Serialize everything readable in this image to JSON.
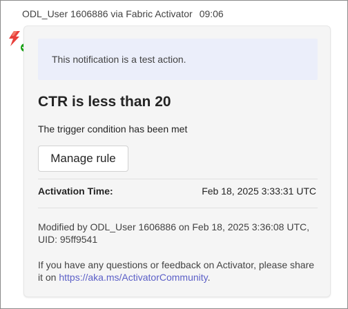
{
  "message": {
    "sender": "ODL_User 1606886 via Fabric Activator",
    "time": "09:06",
    "avatar_icon": "activator-lightning-icon",
    "presence_status": "available",
    "presence_color": "#13a10e"
  },
  "card": {
    "test_notice": "This notification is a test action.",
    "title": "CTR is less than 20",
    "subtitle": "The trigger condition has been met",
    "manage_button_label": "Manage rule",
    "activation_label": "Activation Time:",
    "activation_value": "Feb 18, 2025 3:33:31 UTC",
    "modified_line1": "Modified by ODL_User 1606886 on Feb 18, 2025 3:36:08 UTC,",
    "modified_line2": "UID: 95ff9541",
    "feedback_text": "If you have any questions or feedback on Activator, please share it on",
    "feedback_link": "https://aka.ms/ActivatorCommunity",
    "feedback_suffix": "."
  },
  "colors": {
    "banner_bg": "#ebeefa",
    "card_bg": "#f5f5f5",
    "link": "#5b5fc7",
    "accent_red": "#e8413c"
  }
}
